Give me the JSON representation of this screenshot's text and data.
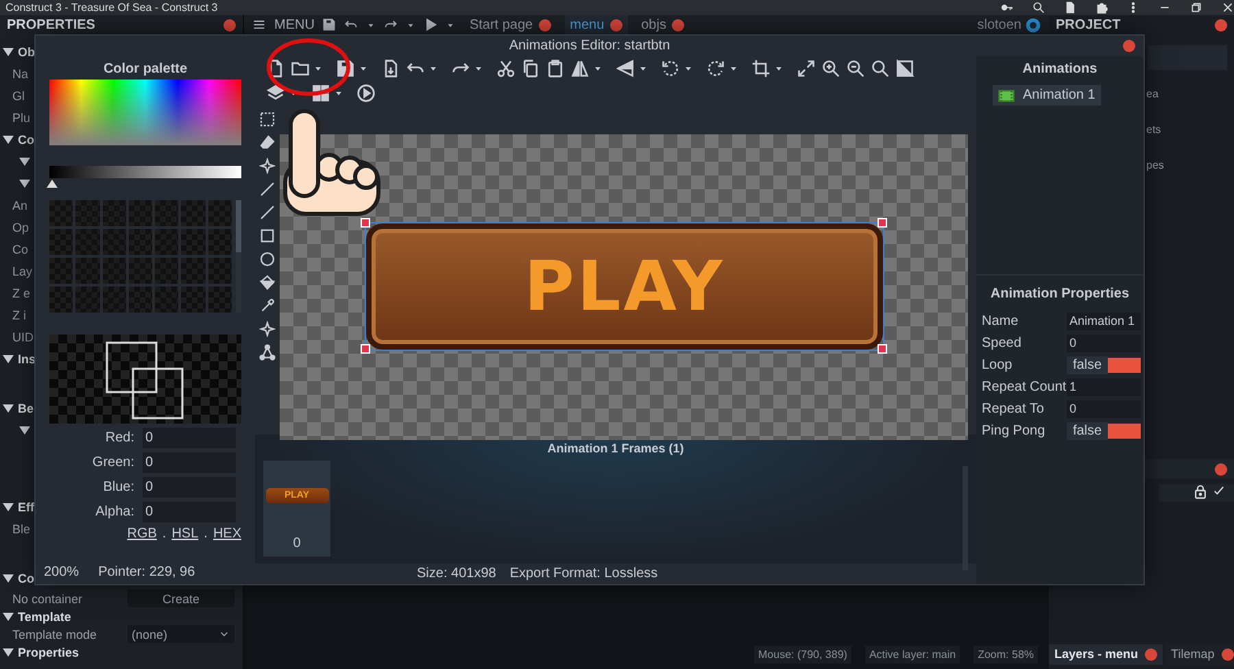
{
  "window": {
    "title": "Construct 3 - Treasure Of Sea - Construct 3"
  },
  "topbar": {
    "properties_title": "PROPERTIES",
    "menu_label": "MENU",
    "tabs": [
      {
        "label": "Start page",
        "selected": false
      },
      {
        "label": "menu",
        "selected": true
      },
      {
        "label": "objs",
        "selected": false
      }
    ],
    "username": "slotoen",
    "project_title": "PROJECT"
  },
  "properties_panel": {
    "rows": [
      {
        "kind": "section",
        "label": "Ob"
      },
      {
        "kind": "field",
        "label": "Na"
      },
      {
        "kind": "field",
        "label": "Gl"
      },
      {
        "kind": "field",
        "label": "Plu"
      },
      {
        "kind": "section",
        "label": "Co"
      },
      {
        "kind": "sub"
      },
      {
        "kind": "sub"
      },
      {
        "kind": "field",
        "label": "An"
      },
      {
        "kind": "field",
        "label": "Op"
      },
      {
        "kind": "field",
        "label": "Co"
      },
      {
        "kind": "field",
        "label": "Lay"
      },
      {
        "kind": "field",
        "label": "Z e"
      },
      {
        "kind": "field",
        "label": "Z i"
      },
      {
        "kind": "field",
        "label": "UID"
      },
      {
        "kind": "section",
        "label": "Ins"
      },
      {
        "kind": "blank"
      },
      {
        "kind": "section",
        "label": "Be"
      },
      {
        "kind": "sub"
      },
      {
        "kind": "blank"
      },
      {
        "kind": "blank"
      },
      {
        "kind": "section",
        "label": "Eff"
      },
      {
        "kind": "field",
        "label": "Ble"
      },
      {
        "kind": "blank"
      },
      {
        "kind": "section",
        "label": "Co"
      },
      {
        "kind": "button",
        "label": "No container",
        "value": "Create"
      },
      {
        "kind": "section",
        "label": "Template"
      },
      {
        "kind": "dropdown",
        "label": "Template mode",
        "value": "(none)"
      },
      {
        "kind": "section",
        "label": "Properties"
      }
    ]
  },
  "project_panel": {
    "items": [
      "ea",
      "ets",
      "pes"
    ]
  },
  "status_bar": {
    "items": [
      "Mouse: (790, 389)",
      "Active layer: main",
      "Zoom: 58%"
    ]
  },
  "bottom_tabs": [
    {
      "label": "Layers - menu",
      "selected": true
    },
    {
      "label": "Tilemap",
      "selected": false
    }
  ],
  "dialog": {
    "title": "Animations Editor: startbtn",
    "palette": {
      "title": "Color palette",
      "brightness": {
        "level": 0
      },
      "channels": [
        {
          "label": "Red:",
          "value": "0"
        },
        {
          "label": "Green:",
          "value": "0"
        },
        {
          "label": "Blue:",
          "value": "0"
        },
        {
          "label": "Alpha:",
          "value": "0"
        }
      ],
      "modes": [
        "RGB",
        "HSL",
        "HEX"
      ],
      "mode_separator": ".",
      "zoom": "200%",
      "pointer": "Pointer: 229, 96"
    },
    "canvas": {
      "sprite_text": "PLAY"
    },
    "frames": {
      "title": "Animation 1 Frames (1)",
      "items": [
        {
          "sprite_text": "PLAY",
          "index": "0"
        }
      ]
    },
    "info": [
      "Size: 401x98",
      "Export Format: Lossless"
    ],
    "animations": {
      "title": "Animations",
      "items": [
        {
          "label": "Animation 1",
          "selected": true
        }
      ]
    },
    "properties": {
      "title": "Animation Properties",
      "rows": [
        {
          "label": "Name",
          "kind": "text",
          "value": "Animation 1"
        },
        {
          "label": "Speed",
          "kind": "text",
          "value": "0"
        },
        {
          "label": "Loop",
          "kind": "toggle",
          "value": "false",
          "on": false
        },
        {
          "label": "Repeat Count",
          "kind": "text",
          "value": "1"
        },
        {
          "label": "Repeat To",
          "kind": "text",
          "value": "0"
        },
        {
          "label": "Ping Pong",
          "kind": "toggle",
          "value": "false",
          "on": false
        }
      ]
    }
  }
}
